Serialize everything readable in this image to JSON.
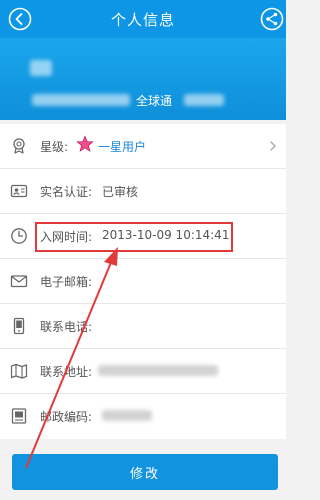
{
  "header": {
    "title": "个人信息",
    "back_icon": "back-arrow-icon",
    "share_icon": "share-icon",
    "bg_color": "#0d96e6"
  },
  "profile": {
    "brand": "全球通",
    "bg_color": "#1aa6ec"
  },
  "rows": {
    "level": {
      "label": "星级:",
      "value": "一星用户",
      "icon": "medal-icon",
      "badge_icon": "star-icon"
    },
    "realname": {
      "label": "实名认证:",
      "value": "已审核",
      "icon": "id-card-icon"
    },
    "jointime": {
      "label": "入网时间:",
      "value": "2013-10-09 10:14:41",
      "icon": "clock-icon"
    },
    "email": {
      "label": "电子邮箱:",
      "icon": "mail-icon"
    },
    "phone": {
      "label": "联系电话:",
      "icon": "phone-icon"
    },
    "address": {
      "label": "联系地址:",
      "icon": "map-icon"
    },
    "postcode": {
      "label": "邮政编码:",
      "icon": "book-icon"
    }
  },
  "footer": {
    "modify_label": "修改",
    "button_color": "#1193e0"
  },
  "annotation": {
    "highlight_color": "#e23a3a"
  }
}
